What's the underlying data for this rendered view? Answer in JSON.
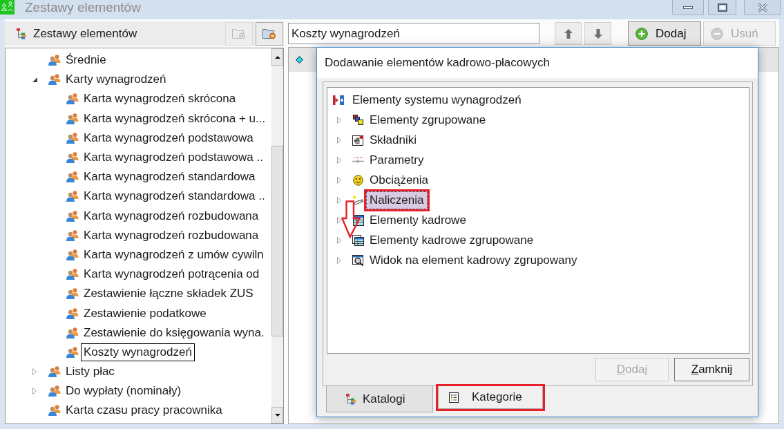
{
  "window": {
    "title": "Zestawy elementów"
  },
  "sets_panel": {
    "title": "Zestawy elementów",
    "toolbar": [
      {
        "kind": "add-folder",
        "disabled": true
      },
      {
        "kind": "remove-folder",
        "disabled": false
      }
    ],
    "tree": [
      {
        "label": "Średnie",
        "selected": false
      },
      {
        "label": "Karty wynagrodzeń",
        "expanded": true,
        "selected": false,
        "children": [
          {
            "label": "Karta wynagrodzeń skrócona",
            "selected": false
          },
          {
            "label": "Karta wynagrodzeń skrócona + u...",
            "selected": false
          },
          {
            "label": "Karta wynagrodzeń podstawowa",
            "selected": false
          },
          {
            "label": "Karta wynagrodzeń podstawowa ..",
            "selected": false
          },
          {
            "label": "Karta wynagrodzeń standardowa",
            "selected": false
          },
          {
            "label": "Karta wynagrodzeń standardowa ..",
            "selected": false
          },
          {
            "label": "Karta wynagrodzeń rozbudowana",
            "selected": false
          },
          {
            "label": "Karta wynagrodzeń rozbudowana",
            "selected": false
          },
          {
            "label": "Karta wynagrodzeń z umów cywiln",
            "selected": false
          },
          {
            "label": "Karta wynagrodzeń potrącenia od",
            "selected": false
          },
          {
            "label": "Zestawienie łączne składek ZUS",
            "selected": false
          },
          {
            "label": "Zestawienie podatkowe",
            "selected": false
          },
          {
            "label": "Zestawienie do księgowania wyna.",
            "selected": false
          },
          {
            "label": "Koszty wynagrodzeń",
            "selected": true
          }
        ]
      },
      {
        "label": "Listy płac",
        "expanded": false,
        "selected": false
      },
      {
        "label": "Do wypłaty (nominały)",
        "expanded": false,
        "selected": false
      },
      {
        "label": "Karta czasu pracy pracownika",
        "selected": false
      }
    ]
  },
  "editor": {
    "name_field": {
      "value": "Koszty wynagrodzeń"
    },
    "move_buttons": [
      {
        "kind": "up"
      },
      {
        "kind": "down"
      }
    ],
    "buttons": [
      {
        "kind": "add",
        "label": "Dodaj",
        "disabled": false
      },
      {
        "kind": "remove",
        "label": "Usuń",
        "disabled": true
      }
    ]
  },
  "dialog": {
    "title": "Dodawanie elementów kadrowo-płacowych",
    "tree": {
      "label": "Elementy systemu wynagrodzeń",
      "children": [
        {
          "label": "Elementy zgrupowane",
          "expanded": false,
          "selected": false,
          "highlighted": false
        },
        {
          "label": "Składniki",
          "expanded": false,
          "selected": false,
          "highlighted": false
        },
        {
          "label": "Parametry",
          "expanded": false,
          "selected": false,
          "highlighted": false
        },
        {
          "label": "Obciążenia",
          "expanded": false,
          "selected": false,
          "highlighted": false
        },
        {
          "label": "Naliczenia",
          "expanded": false,
          "selected": true,
          "highlighted": true
        },
        {
          "label": "Elementy kadrowe",
          "expanded": false,
          "selected": false,
          "highlighted": false
        },
        {
          "label": "Elementy kadrowe zgrupowane",
          "expanded": false,
          "selected": false,
          "highlighted": false
        },
        {
          "label": "Widok na element kadrowy zgrupowany",
          "expanded": false,
          "selected": false,
          "highlighted": false
        }
      ]
    },
    "buttons": [
      {
        "label": "Dodaj",
        "disabled": true,
        "mnemonic": true
      },
      {
        "label": "Zamknij",
        "disabled": false,
        "mnemonic": true
      }
    ],
    "tabs": [
      {
        "label": "Katalogi",
        "selected": false,
        "highlighted": false
      },
      {
        "label": "Kategorie",
        "selected": true,
        "highlighted": true
      }
    ],
    "annotations": [
      {
        "kind": "down-arrow"
      }
    ]
  }
}
